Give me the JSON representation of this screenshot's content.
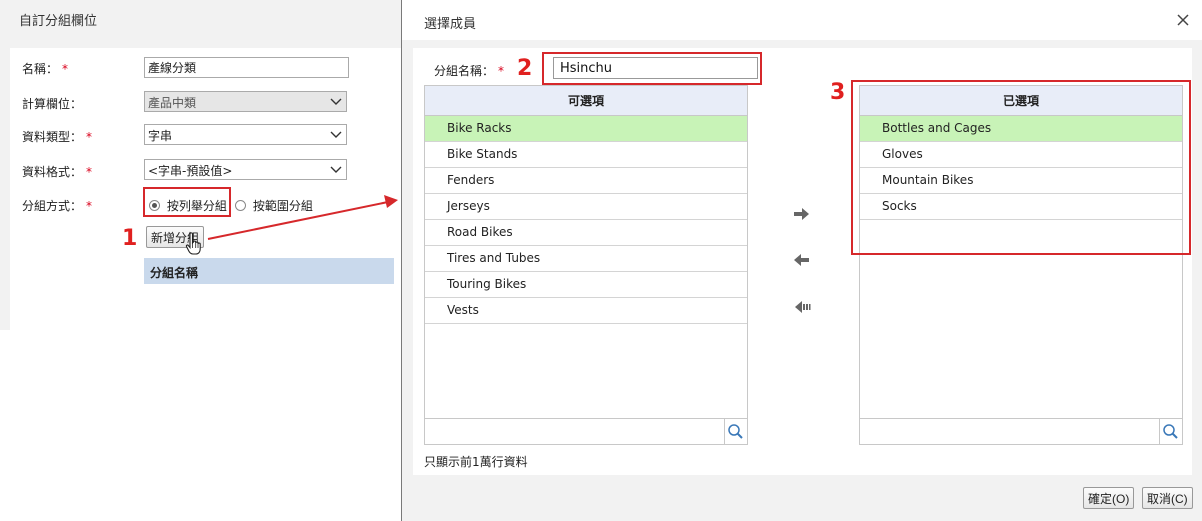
{
  "left_panel": {
    "title": "自訂分組欄位",
    "fields": {
      "name_label": "名稱：",
      "name_value": "產線分類",
      "calc_label": "計算欄位：",
      "calc_value": "產品中類",
      "type_label": "資料類型：",
      "type_value": "字串",
      "format_label": "資料格式：",
      "format_value": "<字串-預設值>",
      "method_label": "分組方式："
    },
    "required_mark": "*",
    "radio_options": [
      {
        "label": "按列舉分組",
        "selected": true
      },
      {
        "label": "按範圍分組",
        "selected": false
      }
    ],
    "add_group_button": "新增分組",
    "group_table_header": "分組名稱"
  },
  "annotations": {
    "n1": "1",
    "n2": "2",
    "n3": "3",
    "color": "#d6282b"
  },
  "dialog": {
    "title": "選擇成員",
    "group_name_label": "分組名稱：",
    "group_name_value": "Hsinchu",
    "available": {
      "header": "可選項",
      "items": [
        "Bike Racks",
        "Bike Stands",
        "Fenders",
        "Jerseys",
        "Road Bikes",
        "Tires and Tubes",
        "Touring Bikes",
        "Vests"
      ],
      "highlighted_index": 0
    },
    "selected": {
      "header": "已選項",
      "items": [
        "Bottles and Cages",
        "Gloves",
        "Mountain Bikes",
        "Socks"
      ],
      "highlighted_index": 0
    },
    "footer_note": "只顯示前1萬行資料",
    "ok_button": "確定(O)",
    "cancel_button": "取消(C)"
  },
  "colors": {
    "highlight": "#c8f3b7",
    "header_bg": "#e8edf8",
    "group_header_bg": "#c9d9ec",
    "required": "#d9001b"
  }
}
